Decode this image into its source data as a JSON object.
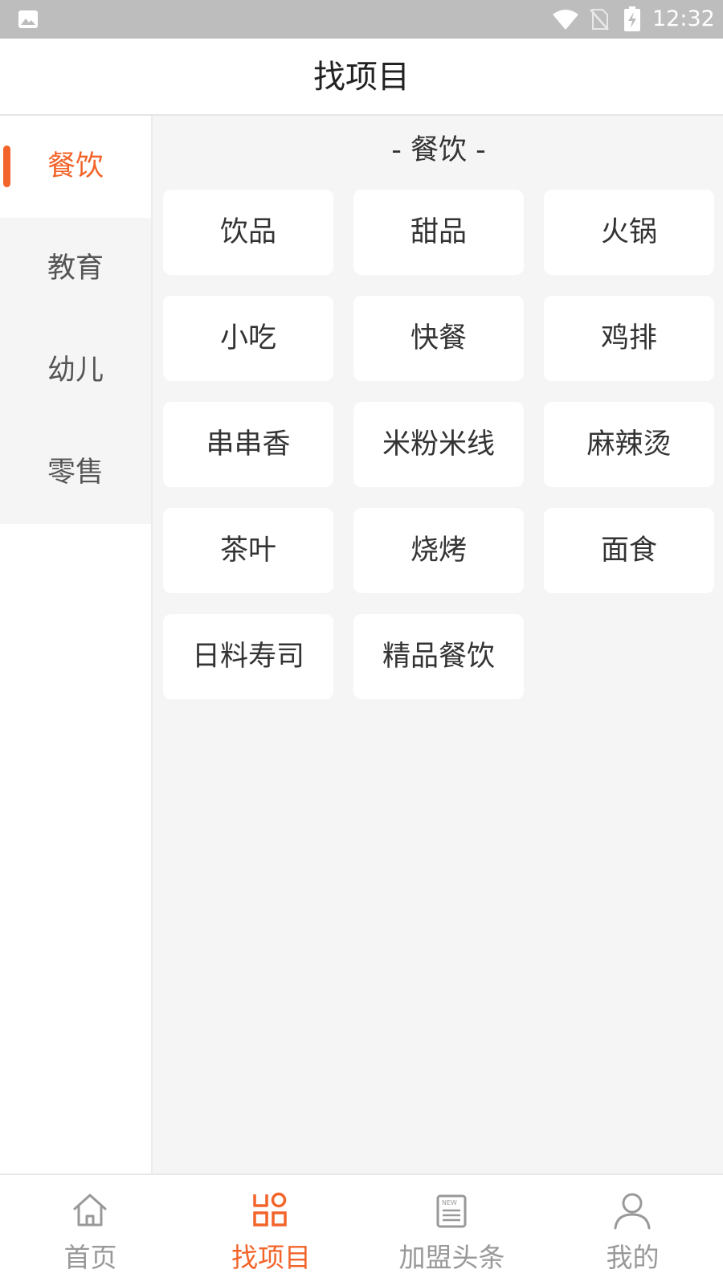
{
  "status_bar": {
    "time": "12:32",
    "icons": [
      "gallery-icon",
      "wifi-icon",
      "no-sim-icon",
      "battery-charging-icon"
    ]
  },
  "header": {
    "title": "找项目"
  },
  "sidebar": {
    "items": [
      {
        "label": "餐饮",
        "active": true
      },
      {
        "label": "教育",
        "active": false
      },
      {
        "label": "幼儿",
        "active": false
      },
      {
        "label": "零售",
        "active": false
      }
    ]
  },
  "main": {
    "section_title": "- 餐饮 -",
    "items": [
      "饮品",
      "甜品",
      "火锅",
      "小吃",
      "快餐",
      "鸡排",
      "串串香",
      "米粉米线",
      "麻辣烫",
      "茶叶",
      "烧烤",
      "面食",
      "日料寿司",
      "精品餐饮"
    ]
  },
  "tabs": [
    {
      "label": "首页",
      "icon": "home-icon",
      "active": false
    },
    {
      "label": "找项目",
      "icon": "grid-icon",
      "active": true
    },
    {
      "label": "加盟头条",
      "icon": "news-icon",
      "active": false
    },
    {
      "label": "我的",
      "icon": "user-icon",
      "active": false
    }
  ],
  "colors": {
    "accent": "#f2642a",
    "inactive": "#999999",
    "background": "#f5f5f5"
  }
}
